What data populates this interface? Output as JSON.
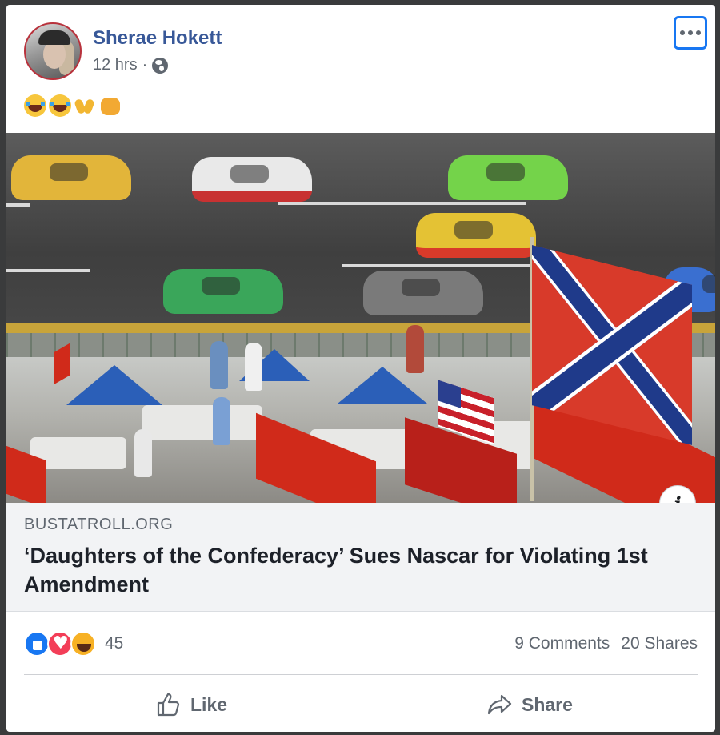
{
  "post": {
    "author": "Sherae Hokett",
    "time": "12 hrs",
    "separator": "·",
    "audience_icon": "globe-icon",
    "more_icon": "more-options-icon",
    "emojis": [
      "laughing-tears-emoji",
      "laughing-tears-emoji",
      "raised-hands-emoji",
      "fist-emoji"
    ]
  },
  "link": {
    "domain": "BUSTATROLL.ORG",
    "title": "‘Daughters of the Confederacy’ Sues Nascar for Violating 1st Amendment",
    "info_label": "i"
  },
  "stats": {
    "reactions": [
      "like",
      "love",
      "haha"
    ],
    "reaction_count": "45",
    "comments": "9 Comments",
    "shares": "20 Shares"
  },
  "actions": {
    "like_label": "Like",
    "share_label": "Share"
  },
  "colors": {
    "author_link": "#385898",
    "secondary_text": "#606770",
    "focus_outline": "#1877f2",
    "link_box_bg": "#f2f3f5"
  }
}
